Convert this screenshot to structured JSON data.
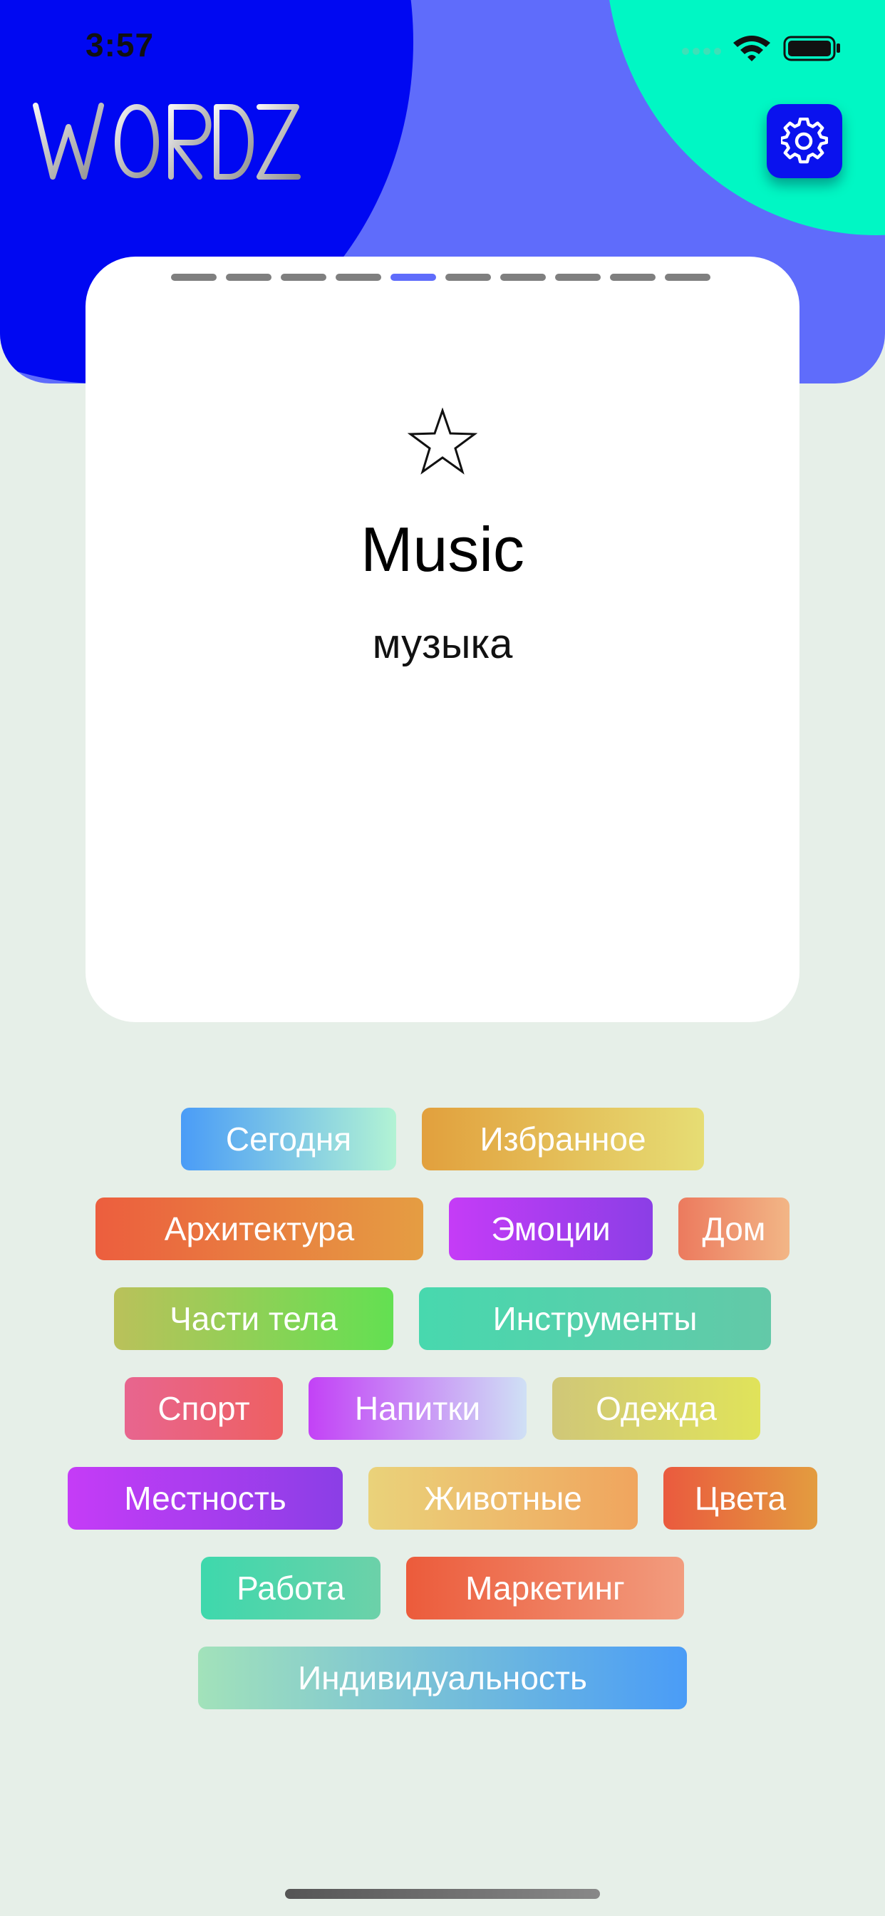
{
  "status_bar": {
    "time": "3:57"
  },
  "app": {
    "logo_text": "WORDZ"
  },
  "settings": {
    "icon": "gear-icon"
  },
  "card": {
    "word": "Music",
    "translation": "музыка",
    "favorite_icon": "star-outline-icon",
    "pager": {
      "total": 10,
      "current": 5
    }
  },
  "categories": [
    [
      {
        "label": "Сегодня",
        "from": "#4a9cf7",
        "to": "#b2f3d4"
      },
      {
        "label": "Избранное",
        "from": "#e2a03d",
        "to": "#e6dd74"
      }
    ],
    [
      {
        "label": "Архитектура",
        "from": "#ec5e3e",
        "to": "#e59d42"
      },
      {
        "label": "Эмоции",
        "from": "#c53cf7",
        "to": "#8b3ee6"
      },
      {
        "label": "Дом",
        "from": "#ec7a5e",
        "to": "#f2b686"
      }
    ],
    [
      {
        "label": "Части тела",
        "from": "#bac15a",
        "to": "#63e052"
      },
      {
        "label": "Инструменты",
        "from": "#48d8ae",
        "to": "#63c9a8"
      }
    ],
    [
      {
        "label": "Спорт",
        "from": "#e8658f",
        "to": "#ee6062"
      },
      {
        "label": "Напитки",
        "from": "#c342f6",
        "to": "#cfe0f5"
      },
      {
        "label": "Одежда",
        "from": "#d0c778",
        "to": "#e0e35a"
      }
    ],
    [
      {
        "label": "Местность",
        "from": "#c53cf7",
        "to": "#8b3ee6"
      },
      {
        "label": "Животные",
        "from": "#ead27a",
        "to": "#f0a55e"
      },
      {
        "label": "Цвета",
        "from": "#ea5a3e",
        "to": "#e39c3f"
      }
    ],
    [
      {
        "label": "Работа",
        "from": "#3ed8ac",
        "to": "#6cd1a9"
      },
      {
        "label": "Маркетинг",
        "from": "#ec5b3b",
        "to": "#f29c7e"
      }
    ],
    [
      {
        "label": "Индивидуальность",
        "from": "#a2e2ba",
        "to": "#4a9cf7"
      }
    ]
  ]
}
